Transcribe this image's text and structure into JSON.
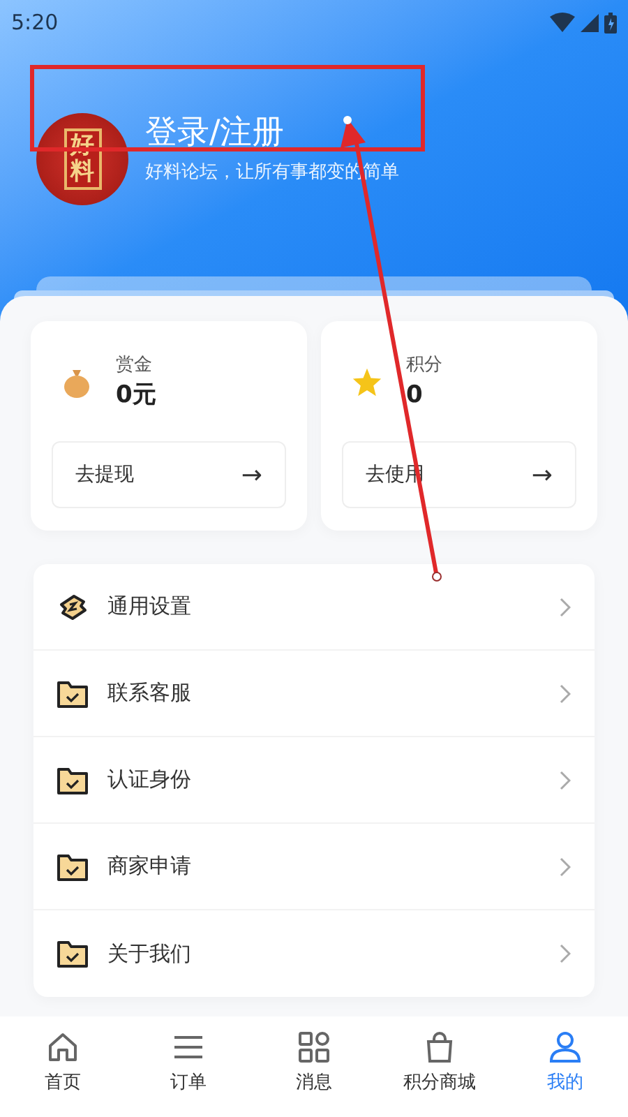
{
  "status_bar": {
    "time": "5:20"
  },
  "profile": {
    "avatar_text": "好料",
    "title": "登录/注册",
    "subtitle": "好料论坛，让所有事都变的简单"
  },
  "stats": [
    {
      "kind": "money",
      "label": "赏金",
      "value": "0元",
      "action": "去提现",
      "arrow": "→"
    },
    {
      "kind": "star",
      "label": "积分",
      "value": "0",
      "action": "去使用",
      "arrow": "→"
    }
  ],
  "menu": [
    {
      "kind": "tools",
      "label": "通用设置"
    },
    {
      "kind": "folder",
      "label": "联系客服"
    },
    {
      "kind": "folder",
      "label": "认证身份"
    },
    {
      "kind": "folder",
      "label": "商家申请"
    },
    {
      "kind": "folder",
      "label": "关于我们"
    }
  ],
  "tab_bar": [
    {
      "kind": "home",
      "label": "首页",
      "selected": false
    },
    {
      "kind": "list",
      "label": "订单",
      "selected": false
    },
    {
      "kind": "grid",
      "label": "消息",
      "selected": false
    },
    {
      "kind": "shop",
      "label": "积分商城",
      "selected": false
    },
    {
      "kind": "person",
      "label": "我的",
      "selected": true
    }
  ]
}
